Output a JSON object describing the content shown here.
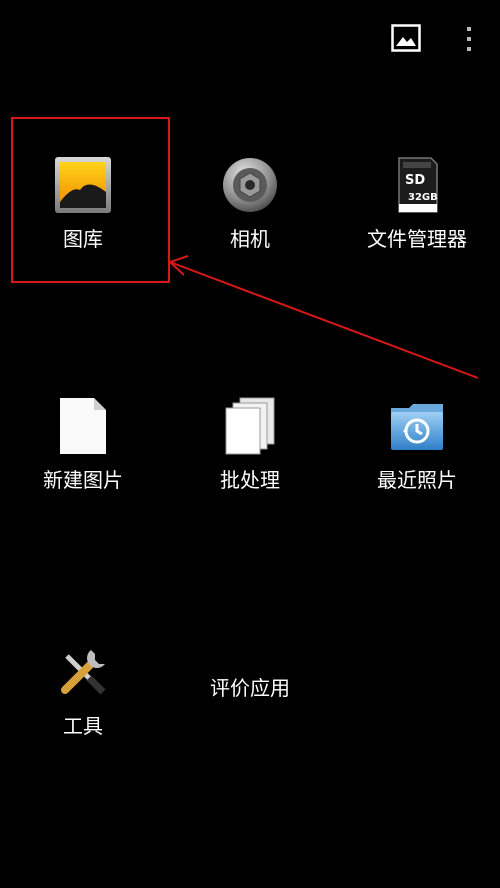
{
  "topbar": {
    "gallery_icon": "image-icon",
    "menu_icon": "more-vert-icon"
  },
  "apps": [
    {
      "label": "图库",
      "icon": "gallery-icon"
    },
    {
      "label": "相机",
      "icon": "camera-icon"
    },
    {
      "label": "文件管理器",
      "icon": "sd-card-icon",
      "sd_text": "SD",
      "sd_capacity": "32GB"
    },
    {
      "label": "新建图片",
      "icon": "new-document-icon"
    },
    {
      "label": "批处理",
      "icon": "batch-pages-icon"
    },
    {
      "label": "最近照片",
      "icon": "recent-folder-icon"
    },
    {
      "label": "工具",
      "icon": "tools-icon"
    },
    {
      "label": "评价应用",
      "icon": ""
    }
  ],
  "annotation": {
    "color": "#d91818",
    "type": "highlight-with-arrow"
  }
}
